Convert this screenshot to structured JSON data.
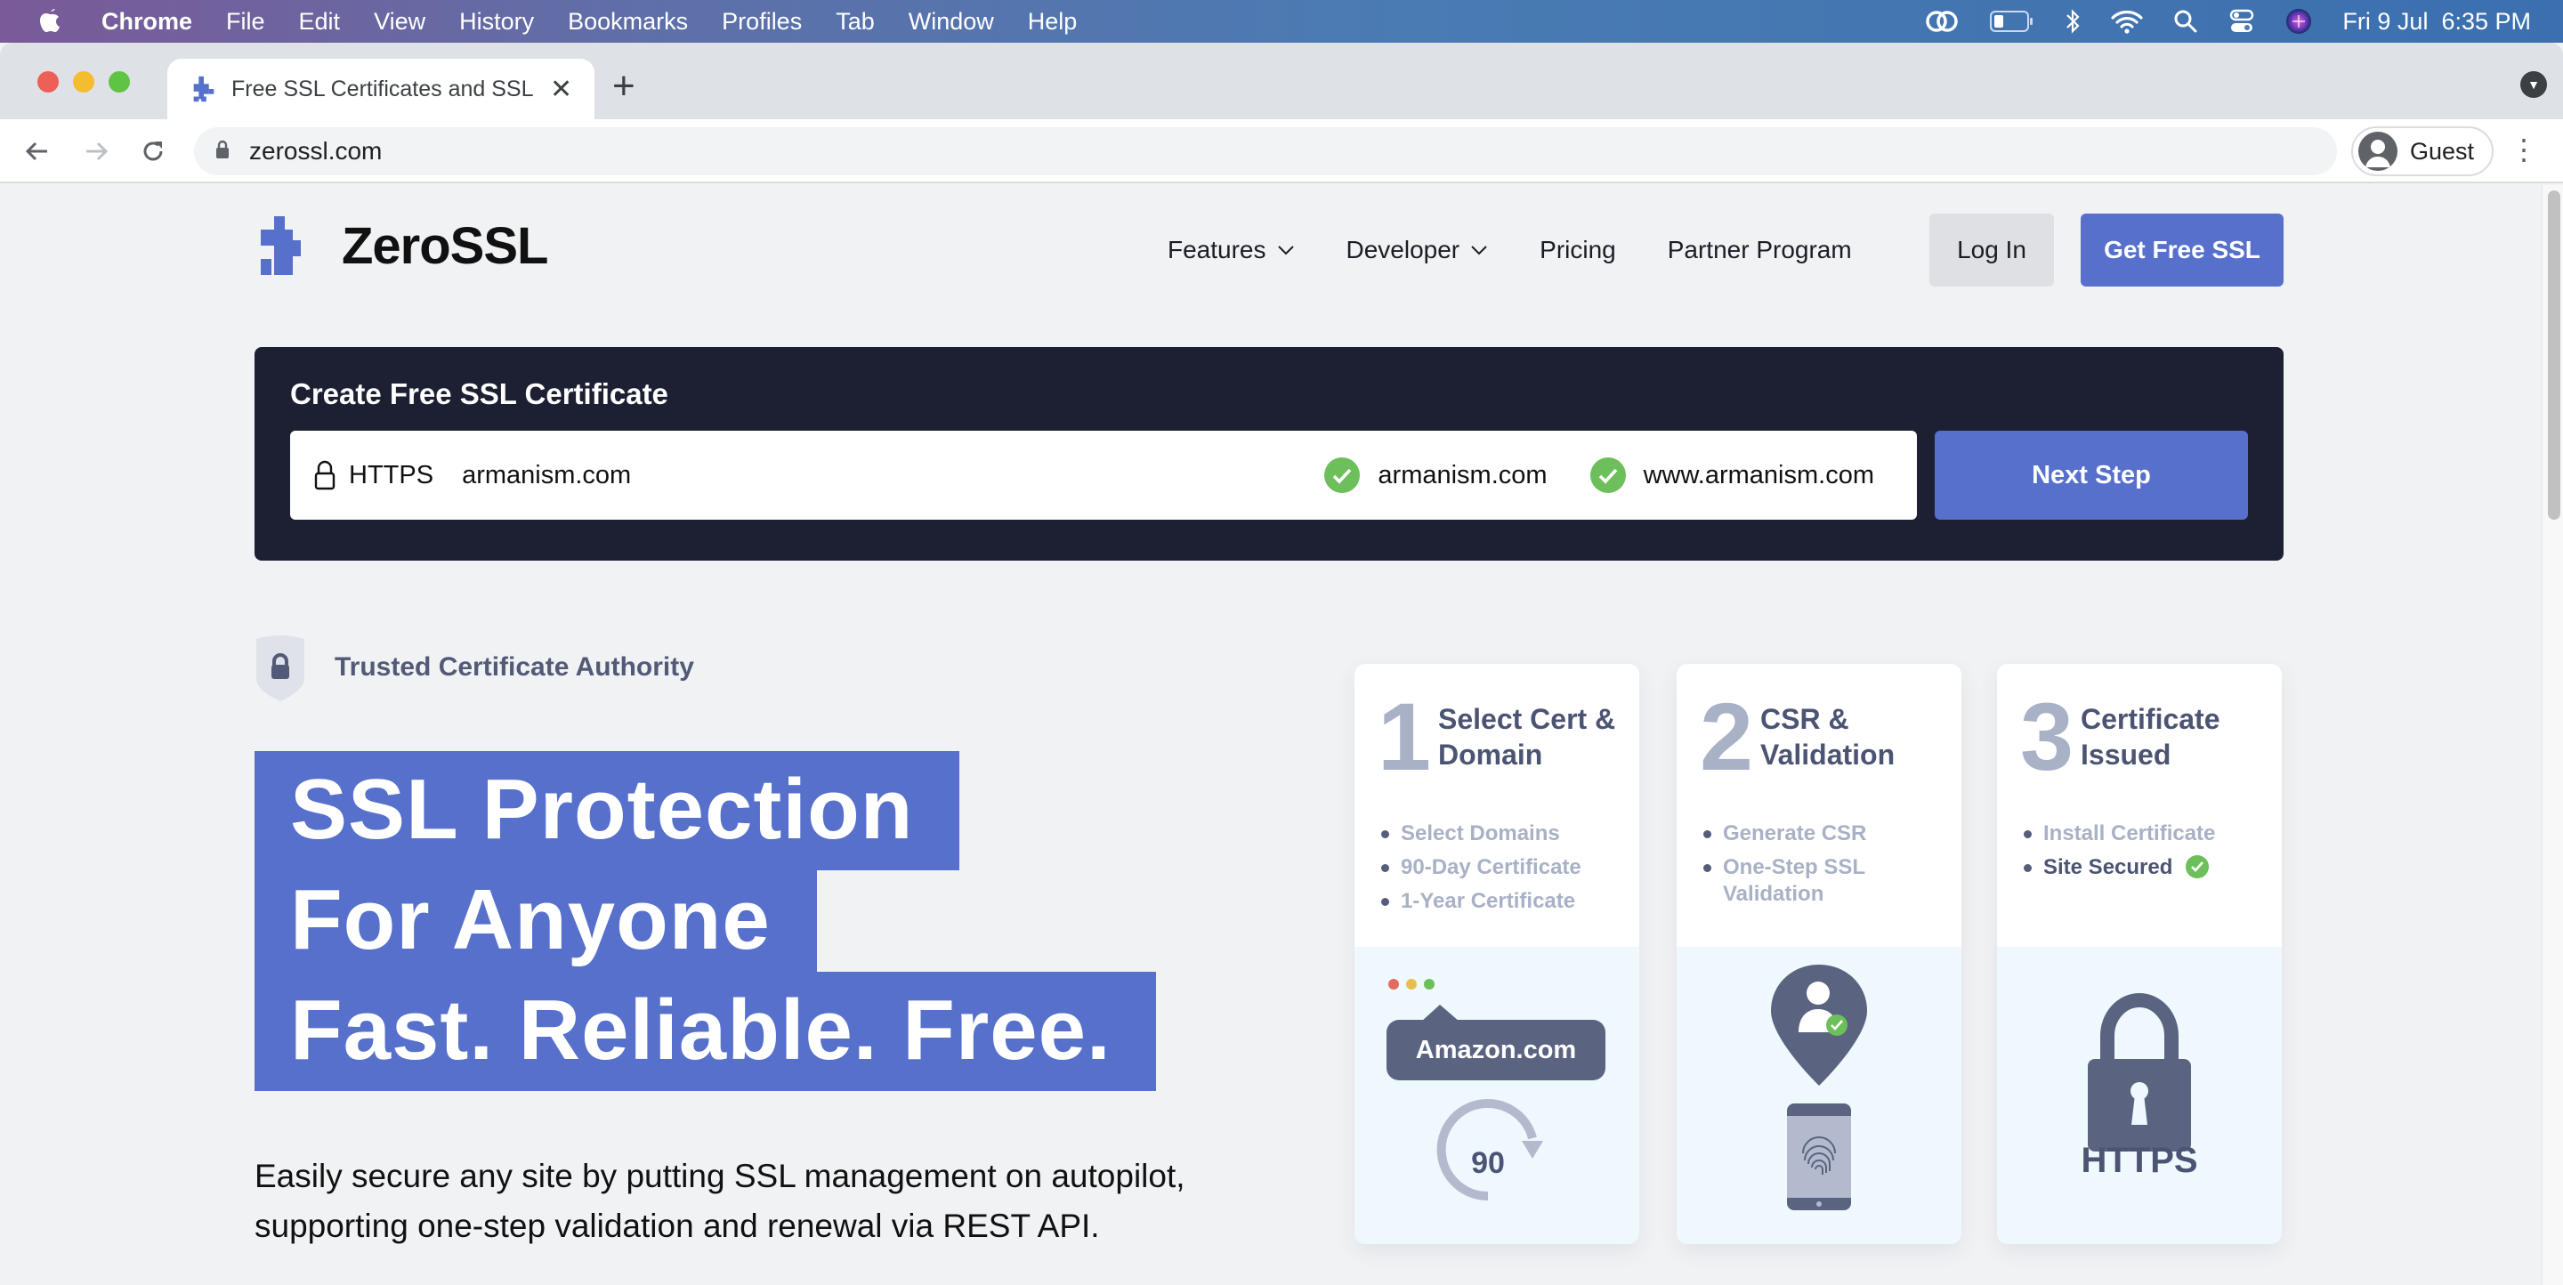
{
  "menubar": {
    "app": "Chrome",
    "items": [
      "File",
      "Edit",
      "View",
      "History",
      "Bookmarks",
      "Profiles",
      "Tab",
      "Window",
      "Help"
    ],
    "clock": "Fri 9 Jul  6:35 PM"
  },
  "browser": {
    "tab_title": "Free SSL Certificates and SSL Tools - ZeroSSL",
    "new_tab": "+",
    "close": "✕",
    "url": "zerossl.com",
    "profile": "Guest"
  },
  "site": {
    "brand": "ZeroSSL",
    "brand_color": "#5670cc",
    "nav": [
      {
        "label": "Features",
        "dropdown": true
      },
      {
        "label": "Developer",
        "dropdown": true
      },
      {
        "label": "Pricing",
        "dropdown": false
      },
      {
        "label": "Partner Program",
        "dropdown": false
      }
    ],
    "login": "Log In",
    "cta": "Get Free SSL"
  },
  "create": {
    "heading": "Create Free SSL Certificate",
    "prefix": "HTTPS",
    "domain_value": "armanism.com",
    "verified_domains": [
      "armanism.com",
      "www.armanism.com"
    ],
    "next": "Next Step"
  },
  "hero": {
    "badge": "Trusted Certificate Authority",
    "lines": [
      "SSL Protection",
      "For Anyone",
      "Fast. Reliable. Free."
    ],
    "description": "Easily secure any site by putting SSL management on autopilot, supporting one-step validation and renewal via REST API."
  },
  "steps": [
    {
      "number": "1",
      "title": "Select Cert & Domain",
      "items": [
        {
          "text": "Select Domains",
          "done": false
        },
        {
          "text": "90-Day Certificate",
          "done": false
        },
        {
          "text": "1-Year Certificate",
          "done": false
        }
      ],
      "illustration": {
        "domain_label": "Amazon.com",
        "renewal_days": "90"
      }
    },
    {
      "number": "2",
      "title": "CSR & Validation",
      "items": [
        {
          "text": "Generate CSR",
          "done": false
        },
        {
          "text": "One-Step SSL Validation",
          "done": false
        }
      ],
      "illustration": {}
    },
    {
      "number": "3",
      "title": "Certificate Issued",
      "items": [
        {
          "text": "Install Certificate",
          "done": false
        },
        {
          "text": "Site Secured",
          "done": true
        }
      ],
      "illustration": {
        "label": "HTTPS"
      }
    }
  ]
}
